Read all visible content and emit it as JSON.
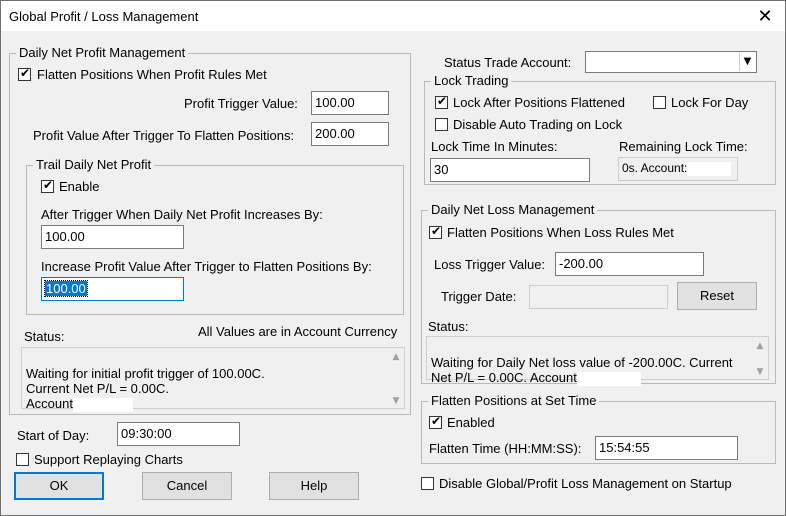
{
  "window": {
    "title": "Global Profit / Loss Management",
    "close_glyph": "✕"
  },
  "profit": {
    "legend": "Daily Net Profit Management",
    "flatten_label": "Flatten Positions When Profit Rules Met",
    "flatten_checked": true,
    "trigger_label": "Profit Trigger Value:",
    "trigger_value": "100.00",
    "after_label": "Profit Value After Trigger To Flatten Positions:",
    "after_value": "200.00",
    "trail": {
      "legend": "Trail Daily Net Profit",
      "enable_label": "Enable",
      "enable_checked": true,
      "increase_label": "After Trigger When Daily Net Profit Increases By:",
      "increase_value": "100.00",
      "inc_flatten_label": "Increase Profit Value After Trigger to Flatten Positions By:",
      "inc_flatten_value": "100.00"
    },
    "status_label": "Status:",
    "currency_note": "All Values are in Account Currency",
    "status_text": "Waiting for initial profit trigger of 100.00C.\nCurrent Net P/L = 0.00C.\nAccount"
  },
  "start_of_day": {
    "label": "Start of Day:",
    "value": "09:30:00"
  },
  "replay": {
    "label": "Support Replaying Charts",
    "checked": false
  },
  "buttons": {
    "ok": "OK",
    "cancel": "Cancel",
    "help": "Help"
  },
  "status_account": {
    "label": "Status Trade Account:",
    "value": ""
  },
  "lock": {
    "legend": "Lock Trading",
    "after_flat_label": "Lock After Positions Flattened",
    "after_flat_checked": true,
    "for_day_label": "Lock For Day",
    "for_day_checked": false,
    "disable_auto_label": "Disable Auto Trading on Lock",
    "disable_auto_checked": false,
    "minutes_label": "Lock Time In Minutes:",
    "minutes_value": "30",
    "remaining_label": "Remaining Lock Time:",
    "remaining_value": "0s. Account:"
  },
  "loss": {
    "legend": "Daily Net Loss Management",
    "flatten_label": "Flatten Positions When Loss Rules Met",
    "flatten_checked": true,
    "trigger_label": "Loss Trigger Value:",
    "trigger_value": "-200.00",
    "date_label": "Trigger Date:",
    "date_value": "",
    "reset_label": "Reset",
    "status_label": "Status:",
    "status_text": "Waiting for Daily Net loss value of -200.00C.  Current\nNet P/L = 0.00C.  Account"
  },
  "flatten_time": {
    "legend": "Flatten Positions at Set Time",
    "enabled_label": "Enabled",
    "enabled_checked": true,
    "time_label": "Flatten Time (HH:MM:SS):",
    "time_value": "15:54:55"
  },
  "disable_startup": {
    "label": "Disable Global/Profit Loss Management on Startup",
    "checked": false
  },
  "colors": {
    "background": "#f0f0f0",
    "selection": "#0078d7",
    "default_button_border": "#0078d7"
  }
}
